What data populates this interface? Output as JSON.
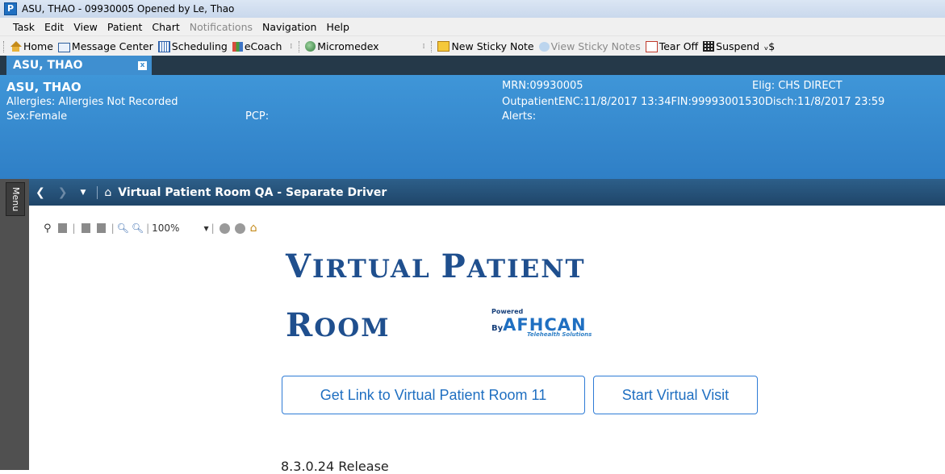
{
  "window": {
    "title": "ASU, THAO  - 09930005 Opened by Le, Thao",
    "app_icon": "P"
  },
  "menubar": [
    "Task",
    "Edit",
    "View",
    "Patient",
    "Chart",
    "Notifications",
    "Navigation",
    "Help"
  ],
  "toolbar": {
    "home": "Home",
    "message_center": "Message Center",
    "scheduling": "Scheduling",
    "ecoach": "eCoach",
    "micromedex": "Micromedex",
    "new_sticky": "New Sticky Note",
    "view_sticky": "View Sticky Notes",
    "tear_off": "Tear Off",
    "suspend": "Suspend"
  },
  "patient_tab": {
    "label": "ASU, THAO",
    "close": "x"
  },
  "banner": {
    "name": "ASU, THAO",
    "allergies": "Allergies: Allergies Not Recorded",
    "sex": "Sex:Female",
    "pcp": "PCP:",
    "mrn": "MRN:09930005",
    "elig": "Elig: CHS  DIRECT",
    "encounter": "OutpatientENC:11/8/2017 13:34FIN:99993001530Disch:11/8/2017 23:59",
    "alerts": "Alerts:"
  },
  "side_menu": {
    "label": "Menu"
  },
  "nav": {
    "room_title": "Virtual Patient Room QA - Separate Driver"
  },
  "viewer": {
    "zoom": "100%"
  },
  "page": {
    "title_line1_first": "V",
    "title_line1_rest": "IRTUAL ",
    "title_line1_p": "P",
    "title_line1_p_rest": "ATIENT",
    "title_line2_first": "R",
    "title_line2_rest": "OOM",
    "logo_powered": "Powered",
    "logo_by": "By",
    "logo_name": "AFHCAN",
    "logo_tagline": "Telehealth Solutions",
    "get_link_button": "Get Link to Virtual Patient Room 11",
    "start_visit_button": "Start Virtual Visit",
    "release": "8.3.0.24 Release"
  },
  "colors": {
    "banner": "#3f96d8",
    "nav": "#1f4568",
    "title_blue": "#1f4f8e",
    "button_blue": "#2e7bd6"
  }
}
